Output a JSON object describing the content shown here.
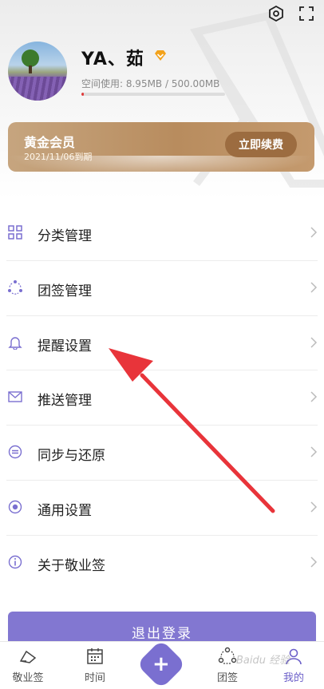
{
  "profile": {
    "username": "YA、茹",
    "storage_text": "空间使用: 8.95MB / 500.00MB",
    "storage_used_fraction": 0.018
  },
  "membership": {
    "title": "黄金会员",
    "expire": "2021/11/06到期",
    "renew_label": "立即续费"
  },
  "menu": {
    "items": [
      {
        "label": "分类管理",
        "icon": "grid-icon"
      },
      {
        "label": "团签管理",
        "icon": "team-cycle-icon"
      },
      {
        "label": "提醒设置",
        "icon": "bell-icon"
      },
      {
        "label": "推送管理",
        "icon": "mail-icon"
      },
      {
        "label": "同步与还原",
        "icon": "sync-icon"
      },
      {
        "label": "通用设置",
        "icon": "radio-dot-icon"
      },
      {
        "label": "关于敬业签",
        "icon": "info-icon"
      }
    ]
  },
  "logout_label": "退出登录",
  "tabs": [
    {
      "label": "敬业签",
      "icon": "notes-icon"
    },
    {
      "label": "时间",
      "icon": "calendar-icon"
    },
    {
      "label": "团签",
      "icon": "team-icon"
    },
    {
      "label": "我的",
      "icon": "person-icon",
      "active": true
    }
  ],
  "watermark": "Baidu 经验",
  "colors": {
    "accent": "#7a6fd0",
    "gold": "#b88c5e",
    "storage_bar": "#e03b3b",
    "annotation_arrow": "#e8343a"
  }
}
